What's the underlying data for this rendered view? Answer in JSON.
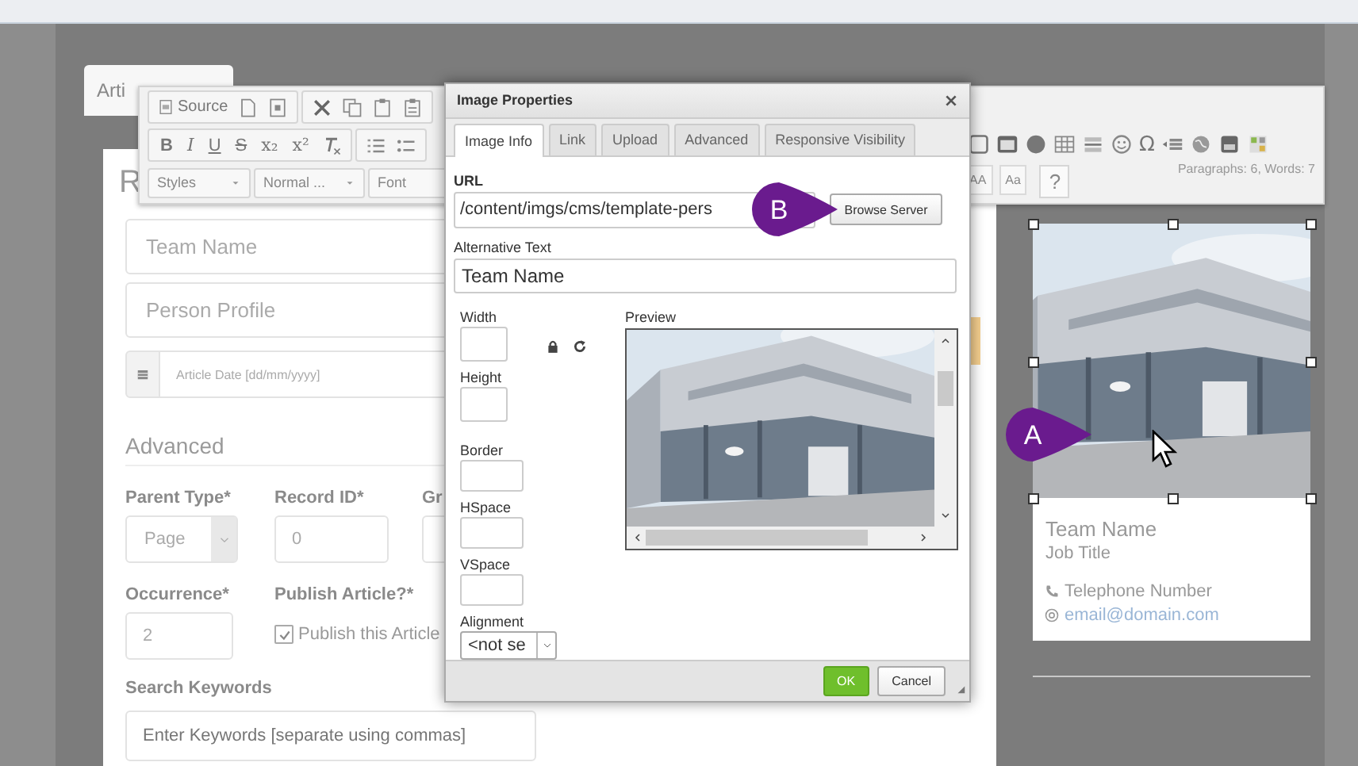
{
  "page_tab": {
    "label": "Arti"
  },
  "toolbar": {
    "source_button": "Source",
    "format_buttons": [
      {
        "label": "B",
        "kind": "bold"
      },
      {
        "label": "I",
        "kind": "italic"
      },
      {
        "label": "U",
        "kind": "underline"
      },
      {
        "label": "S",
        "kind": "strike"
      },
      {
        "label": "x₂",
        "kind": "plain"
      },
      {
        "label": "x²",
        "kind": "plain"
      }
    ],
    "dropdowns": [
      "Styles",
      "Normal ...",
      "Font"
    ],
    "symbol_button": "Ω",
    "case_buttons": [
      "AA",
      "Aa"
    ],
    "help_button": "?",
    "status": "Paragraphs: 6, Words: 7"
  },
  "form": {
    "heading": "R",
    "fields": [
      {
        "placeholder": "Team Name"
      },
      {
        "placeholder": "Person Profile"
      }
    ],
    "date_field": {
      "placeholder": "Article Date [dd/mm/yyyy]"
    },
    "section_heading": "Advanced",
    "row_1": [
      {
        "label": "Parent Type*",
        "kind": "select",
        "value": "Page"
      },
      {
        "label": "Record ID*",
        "kind": "input",
        "value": "0"
      },
      {
        "label": "Gr",
        "kind": "input"
      }
    ],
    "row_2": [
      {
        "label": "Occurrence*",
        "kind": "input",
        "value": "2"
      },
      {
        "label": "Publish Article?*",
        "kind": "checkbox",
        "text": "Publish this Article",
        "checked": true
      }
    ],
    "keywords": {
      "label": "Search Keywords",
      "placeholder": "Enter Keywords [separate using commas]"
    }
  },
  "dialog": {
    "title": "Image Properties",
    "tabs": [
      {
        "label": "Image Info",
        "selected": true
      },
      {
        "label": "Link",
        "selected": false
      },
      {
        "label": "Upload",
        "selected": false
      },
      {
        "label": "Advanced",
        "selected": false
      },
      {
        "label": "Responsive Visibility",
        "selected": false
      }
    ],
    "url": {
      "label": "URL",
      "value": "/content/imgs/cms/template-pers"
    },
    "browse_button": "Browse Server",
    "alt_text": {
      "label": "Alternative Text",
      "value": "Team Name"
    },
    "size_fields": [
      {
        "label": "Width"
      },
      {
        "label": "Height"
      }
    ],
    "spacing_fields": [
      {
        "label": "Border"
      },
      {
        "label": "HSpace"
      },
      {
        "label": "VSpace"
      }
    ],
    "alignment": {
      "label": "Alignment",
      "value": "<not se"
    },
    "preview_label": "Preview",
    "buttons": [
      {
        "label": "OK",
        "kind": "primary"
      },
      {
        "label": "Cancel",
        "kind": "secondary"
      }
    ]
  },
  "profile_card": {
    "name": "Team Name",
    "job_title": "Job Title",
    "phone": "Telephone Number",
    "email": "email@domain.com"
  },
  "callouts": [
    {
      "letter": "A"
    },
    {
      "letter": "B"
    }
  ]
}
